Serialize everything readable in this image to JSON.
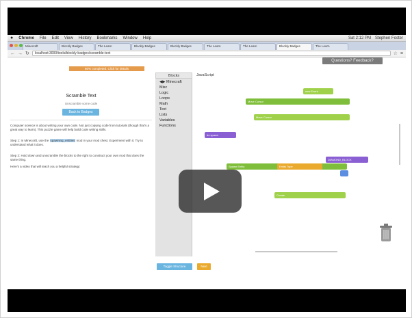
{
  "menubar": {
    "apple": "",
    "items": [
      "Chrome",
      "File",
      "Edit",
      "View",
      "History",
      "Bookmarks",
      "Window",
      "Help"
    ],
    "clock": "Sat 2:12 PM",
    "user": "Stephen Foster"
  },
  "tabs": [
    "Minecraft",
    "Blockly Badges",
    "The Learn",
    "Blockly Badges",
    "Blockly Badges",
    "The Learn",
    "The Learn",
    "Blockly Badges",
    "The Learn"
  ],
  "address": {
    "url": "localhost:3000/tools/blockly-badges/scramble-text"
  },
  "feedback_label": "Questions? Feedback?",
  "progress_label": "60% completed. Click for details",
  "left": {
    "title": "Scramble Text",
    "subtitle": "Unscramble some code",
    "back_button": "Back to Badges",
    "para1": "Computer science is about writing your own code. Not just copying code from tutorials (though that's a great way to learn). This puzzle game will help build code writing skills.",
    "para2_a": "Step 1: In Minecraft, use the",
    "para2_highlight": "spawning_entities",
    "para2_b": "mod in your mod chest. Experiment with it. Try to understand what it does.",
    "para3": "Step 2: Hold down and unscramble the blocks to the right to construct your own mod that does the same thing.",
    "para4": "Here's a video that will teach you a helpful strategy:"
  },
  "workspace": {
    "tab_blocks": "Blocks",
    "tab_js": "JavaScript",
    "toolbox": [
      "Minecraft",
      "Misc",
      "Logic",
      "Loops",
      "Math",
      "Text",
      "Lists",
      "Variables",
      "Functions"
    ],
    "blocks": [
      "new Event",
      "Move Cursor",
      "Move Cursor",
      "do spawn",
      "Spawn Entity",
      "Entity Type",
      "DIAMOND_BLOCK",
      "Create"
    ],
    "toggle_button": "Toggle Structure",
    "next_button": "Next"
  },
  "colors": {
    "accent_blue": "#6ab4e0",
    "accent_orange": "#e59b4c",
    "block_green": "#9fd14a",
    "block_purple": "#8a5fd3"
  }
}
